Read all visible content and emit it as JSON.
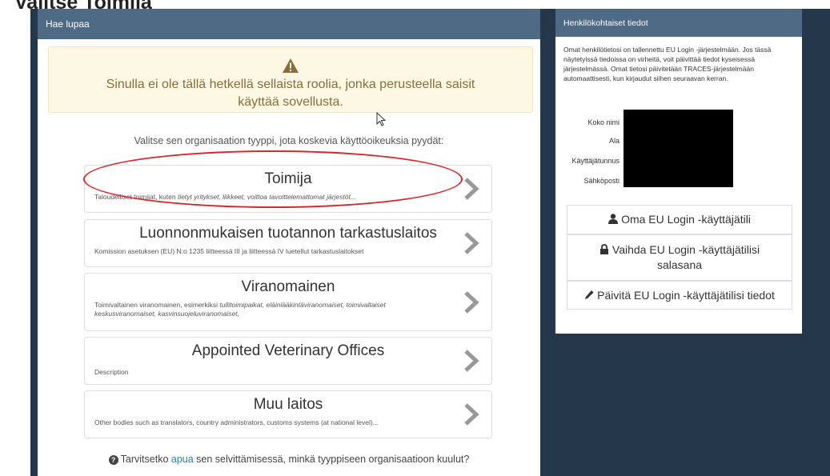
{
  "page_heading": "Valitse Toimija",
  "request_panel": {
    "header": "Hae lupaa",
    "alert_text": "Sinulla ei ole tällä hetkellä sellaista roolia, jonka perusteella saisit käyttää sovellusta.",
    "select_prompt": "Valitse sen organisaation tyyppi, jota koskevia käyttöoikeuksia pyydät:",
    "org_types": [
      {
        "title": "Toimija",
        "desc_plain": "Taloudelliset toimijat, kuten ",
        "desc_italic": "tietyt yritykset, liikkeet, voittoa tavoittelemattomat järjestöt..."
      },
      {
        "title": "Luonnonmukaisen tuotannon tarkastuslaitos",
        "desc_plain": "Komission asetuksen (EU) N:o 1235 liitteessä III ja liitteessä IV luetellut tarkastuslaitokset",
        "desc_italic": ""
      },
      {
        "title": "Viranomainen",
        "desc_plain": "Toimivaltainen viranomainen, esimerkiksi ",
        "desc_italic": "tullitoimipaikat, eläinlääkintäviranomaiset, toimivaltaiset keskusviranomaiset, kasvinsuojeluviranomaiset,"
      },
      {
        "title": "Appointed Veterinary Offices",
        "desc_plain": "Description",
        "desc_italic": ""
      },
      {
        "title": "Muu laitos",
        "desc_plain": "Other bodies such as translators, country administrators, customs systems (at national level)...",
        "desc_italic": ""
      }
    ],
    "help_prefix": "Tarvitsetko ",
    "help_link": "apua",
    "help_suffix": " sen selvittämisessä, minkä tyyppiseen organisaatioon kuulut?"
  },
  "personal_panel": {
    "header": "Henkilökohtaiset tiedot",
    "intro": "Omat henkilötietosi on tallennettu EU Login -järjestelmään. Jos tässä näytetyissä tiedoissa on virheitä, voit päivittää tiedot kyseisessä järjestelmässä. Omat tietosi päivitetään TRACES-järjestelmään automaattisesti, kun kirjaudut siihen seuraavan kerran.",
    "labels": [
      "Koko nimi",
      "Ala",
      "Käyttäjätunnus",
      "Sähköposti"
    ],
    "buttons": {
      "account": "Oma EU Login -käyttäjätili",
      "password": "Vaihda EU Login -käyttäjätilisi salasana",
      "update": "Päivitä EU Login -käyttäjätilisi tiedot"
    }
  },
  "icons": [
    "warning-icon",
    "chevron-right-icon",
    "question-circle-icon",
    "user-icon",
    "lock-icon",
    "pencil-icon",
    "mouse-cursor-icon"
  ],
  "colors": {
    "panel_header": "#4f6a84",
    "background": "#25374a",
    "alert_bg": "#fcf8e3",
    "alert_text": "#8a6d3b",
    "link": "#2a7ab8",
    "highlight": "#d9262b"
  }
}
